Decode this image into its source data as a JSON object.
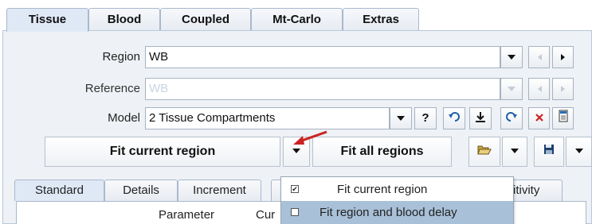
{
  "tabs": [
    "Tissue",
    "Blood",
    "Coupled",
    "Mt-Carlo",
    "Extras"
  ],
  "region": {
    "label": "Region",
    "value": "WB"
  },
  "reference": {
    "label": "Reference",
    "value": "WB"
  },
  "model": {
    "label": "Model",
    "value": "2 Tissue Compartments",
    "help": "?"
  },
  "actions": {
    "fit_current": "Fit current region",
    "fit_all": "Fit all regions"
  },
  "subtabs": [
    "Standard",
    "Details",
    "Increment",
    "itivity"
  ],
  "table": {
    "col_parameter": "Parameter",
    "col_current": "Cur"
  },
  "menu": {
    "items": [
      {
        "label": "Fit current region",
        "checked": true
      },
      {
        "label": "Fit region and blood delay",
        "checked": false
      }
    ]
  },
  "colors": {
    "accent": "#cc2222",
    "panel": "#eef1f5",
    "highlight": "#a8c0d8"
  }
}
